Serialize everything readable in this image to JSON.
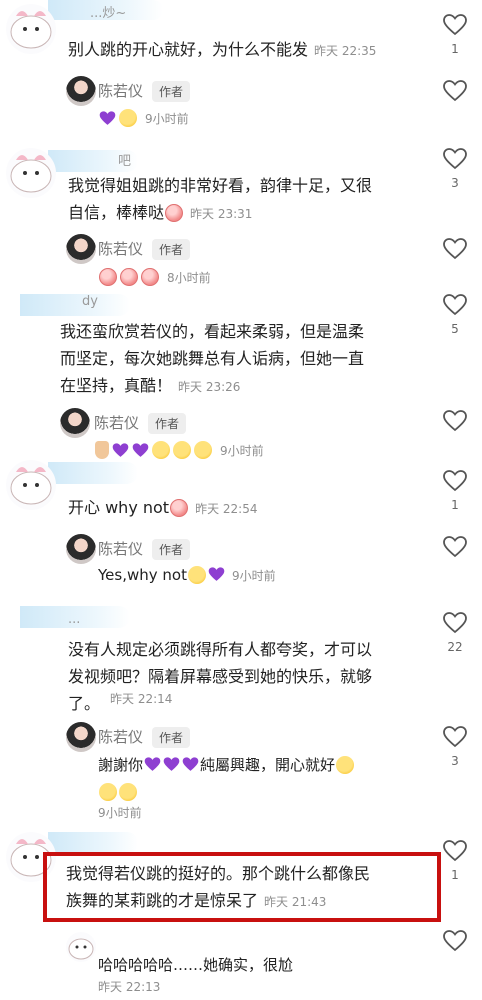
{
  "app": {
    "highlight_color": "#c8100f",
    "icon": "heart-outline-icon"
  },
  "comments": [
    {
      "name_faded": "...炒~",
      "text": "别人跳的开心就好，为什么不能发",
      "time": "昨天 22:35",
      "likes": "1",
      "reply": {
        "name": "陈若仪",
        "badge": "作者",
        "emojis": [
          "purple-heart",
          "party-face"
        ],
        "time": "9小时前"
      }
    },
    {
      "name_faded": "吧",
      "text_lines": [
        "我觉得姐姐跳的非常好看，韵律十足，又很",
        "自信，棒棒哒"
      ],
      "time": "昨天 23:31",
      "likes": "3",
      "reply": {
        "name": "陈若仪",
        "badge": "作者",
        "emojis": [
          "peach",
          "peach",
          "peach"
        ],
        "time": "8小时前"
      }
    },
    {
      "name_faded": "dy",
      "text_lines": [
        "我还蛮欣赏若仪的，看起来柔弱，但是温柔",
        "而坚定，每次她跳舞总有人诟病，但她一直",
        "在坚持，真酷！"
      ],
      "time": "昨天 23:26",
      "likes": "5",
      "reply": {
        "name": "陈若仪",
        "badge": "作者",
        "emojis": [
          "pray",
          "purple-heart",
          "purple-heart",
          "kiss",
          "kiss",
          "kiss"
        ],
        "time": "9小时前"
      }
    },
    {
      "text": "开心 why not",
      "time": "昨天 22:54",
      "likes": "1",
      "reply": {
        "name": "陈若仪",
        "badge": "作者",
        "text": "Yes,why not",
        "emojis": [
          "laugh",
          "purple-heart"
        ],
        "time": "9小时前"
      }
    },
    {
      "name_faded": "...",
      "text_lines": [
        "没有人规定必须跳得所有人都夸奖，才可以",
        "发视频吧？隔着屏幕感受到她的快乐，就够",
        "了。"
      ],
      "time": "昨天 22:14",
      "likes": "22",
      "reply": {
        "name": "陈若仪",
        "badge": "作者",
        "text": "謝謝你",
        "text_after": "純屬興趣，開心就好",
        "likes": "3",
        "time": "9小时前"
      }
    },
    {
      "text_lines": [
        "我觉得若仪跳的挺好的。那个跳什么都像民",
        "族舞的某莉跳的才是惊呆了"
      ],
      "time": "昨天 21:43",
      "likes": "1",
      "reply": {
        "text": "哈哈哈哈哈……她确实，很尬",
        "time": "昨天 22:13"
      }
    }
  ]
}
